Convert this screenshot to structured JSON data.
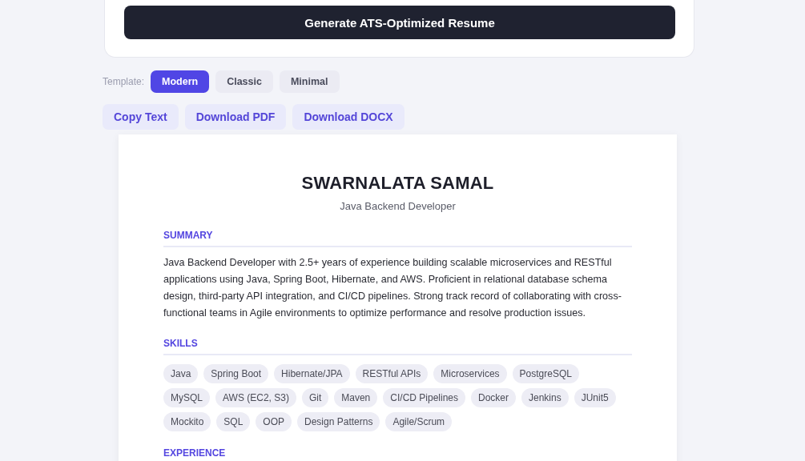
{
  "generate_button": {
    "label": "Generate ATS-Optimized Resume"
  },
  "template": {
    "label": "Template:",
    "options": [
      {
        "label": "Modern",
        "selected": true
      },
      {
        "label": "Classic",
        "selected": false
      },
      {
        "label": "Minimal",
        "selected": false
      }
    ]
  },
  "actions": [
    "Copy Text",
    "Download PDF",
    "Download DOCX"
  ],
  "resume": {
    "name": "SWARNALATA SAMAL",
    "title": "Java Backend Developer",
    "sections": [
      {
        "heading": "SUMMARY",
        "kind": "text",
        "text": "Java Backend Developer with 2.5+ years of experience building scalable microservices and RESTful applications using Java, Spring Boot, Hibernate, and AWS. Proficient in relational database schema design, third-party API integration, and CI/CD pipelines. Strong track record of collaborating with cross-functional teams in Agile environments to optimize performance and resolve production issues."
      },
      {
        "heading": "SKILLS",
        "kind": "tags",
        "tags": [
          "Java",
          "Spring Boot",
          "Hibernate/JPA",
          "RESTful APIs",
          "Microservices",
          "PostgreSQL",
          "MySQL",
          "AWS (EC2, S3)",
          "Git",
          "Maven",
          "CI/CD Pipelines",
          "Docker",
          "Jenkins",
          "JUnit5",
          "Mockito",
          "SQL",
          "OOP",
          "Design Patterns",
          "Agile/Scrum"
        ]
      },
      {
        "heading": "EXPERIENCE",
        "kind": "text"
      }
    ]
  }
}
